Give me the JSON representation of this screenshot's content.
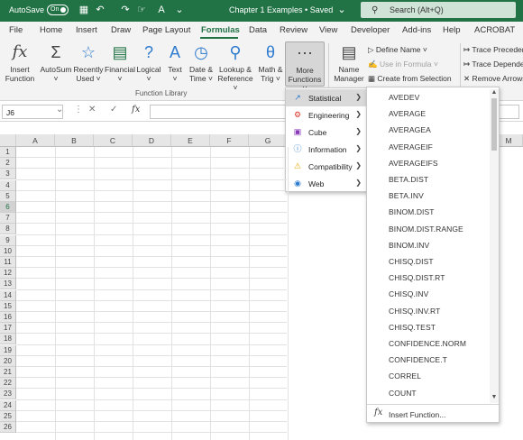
{
  "titlebar": {
    "autosave_label": "AutoSave",
    "autosave_state": "On",
    "doc_title": "Chapter 1 Examples • Saved",
    "search_placeholder": "Search (Alt+Q)",
    "bg_color": "#217346"
  },
  "tabs": [
    "File",
    "Home",
    "Insert",
    "Draw",
    "Page Layout",
    "Formulas",
    "Data",
    "Review",
    "View",
    "Developer",
    "Add-ins",
    "Help",
    "ACROBAT"
  ],
  "active_tab": "Formulas",
  "ribbon": {
    "buttons": [
      {
        "name": "insert-function-button",
        "l1": "Insert",
        "l2": "Function",
        "icon": "fx-icon"
      },
      {
        "name": "autosum-button",
        "l1": "AutoSum",
        "l2": "˅",
        "icon": "sigma-icon"
      },
      {
        "name": "recently-used-button",
        "l1": "Recently",
        "l2": "Used ˅",
        "icon": "star-book-icon"
      },
      {
        "name": "financial-button",
        "l1": "Financial",
        "l2": "˅",
        "icon": "coins-icon"
      },
      {
        "name": "logical-button",
        "l1": "Logical",
        "l2": "˅",
        "icon": "question-book-icon"
      },
      {
        "name": "text-button",
        "l1": "Text",
        "l2": "˅",
        "icon": "text-book-icon"
      },
      {
        "name": "date-time-button",
        "l1": "Date &",
        "l2": "Time ˅",
        "icon": "clock-book-icon"
      },
      {
        "name": "lookup-reference-button",
        "l1": "Lookup &",
        "l2": "Reference ˅",
        "icon": "search-book-icon"
      },
      {
        "name": "math-trig-button",
        "l1": "Math &",
        "l2": "Trig ˅",
        "icon": "theta-book-icon"
      },
      {
        "name": "more-functions-button",
        "l1": "More",
        "l2": "Functions ˅",
        "icon": "more-book-icon"
      }
    ],
    "group_label": "Function Library",
    "name_manager": {
      "l1": "Name",
      "l2": "Manager"
    },
    "defined_names": [
      "Define Name ˅",
      "Use in Formula ˅",
      "Create from Selection"
    ],
    "auditing": [
      "Trace Precedents",
      "Trace Dependents",
      "Remove Arrows ˅"
    ]
  },
  "formula_bar": {
    "name_box": "J6",
    "cancel_icon": "✕",
    "enter_icon": "✓",
    "fx_label": "fx"
  },
  "columns": [
    "A",
    "B",
    "C",
    "D",
    "E",
    "F",
    "G",
    "M"
  ],
  "rows": [
    "1",
    "2",
    "3",
    "4",
    "5",
    "6",
    "7",
    "8",
    "9",
    "10",
    "11",
    "12",
    "13",
    "14",
    "15",
    "16",
    "17",
    "18",
    "19",
    "20",
    "21",
    "22",
    "23",
    "24",
    "25",
    "26"
  ],
  "selected_row": "6",
  "more_functions_menu": [
    {
      "label": "Statistical",
      "icon": "stats-chart-icon",
      "color": "#2e7bcf"
    },
    {
      "label": "Engineering",
      "icon": "engineering-icon",
      "color": "#d9352b"
    },
    {
      "label": "Cube",
      "icon": "cube-icon",
      "color": "#8a3ab9"
    },
    {
      "label": "Information",
      "icon": "info-icon",
      "color": "#2e7bcf"
    },
    {
      "label": "Compatibility",
      "icon": "compat-icon",
      "color": "#e2a800"
    },
    {
      "label": "Web",
      "icon": "web-icon",
      "color": "#2e7bcf"
    }
  ],
  "statistical_functions": [
    "AVEDEV",
    "AVERAGE",
    "AVERAGEA",
    "AVERAGEIF",
    "AVERAGEIFS",
    "BETA.DIST",
    "BETA.INV",
    "BINOM.DIST",
    "BINOM.DIST.RANGE",
    "BINOM.INV",
    "CHISQ.DIST",
    "CHISQ.DIST.RT",
    "CHISQ.INV",
    "CHISQ.INV.RT",
    "CHISQ.TEST",
    "CONFIDENCE.NORM",
    "CONFIDENCE.T",
    "CORREL",
    "COUNT"
  ],
  "insert_function_label": "Insert Function...",
  "accent_color": "#217346"
}
